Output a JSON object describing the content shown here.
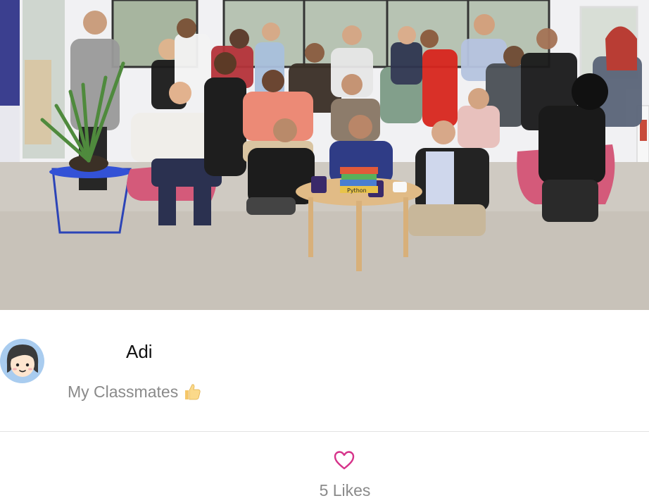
{
  "photo": {
    "subject": "group-photo",
    "book_spine_text": "Python"
  },
  "post": {
    "author_name": "Adi",
    "caption_text": "My Classmates",
    "caption_emoji_icon": "thumbs-up-icon",
    "avatar_icon": "girl-avatar-icon"
  },
  "likes": {
    "count_text": "5 Likes",
    "icon": "heart-outline-icon",
    "accent_color": "#d6338a"
  }
}
